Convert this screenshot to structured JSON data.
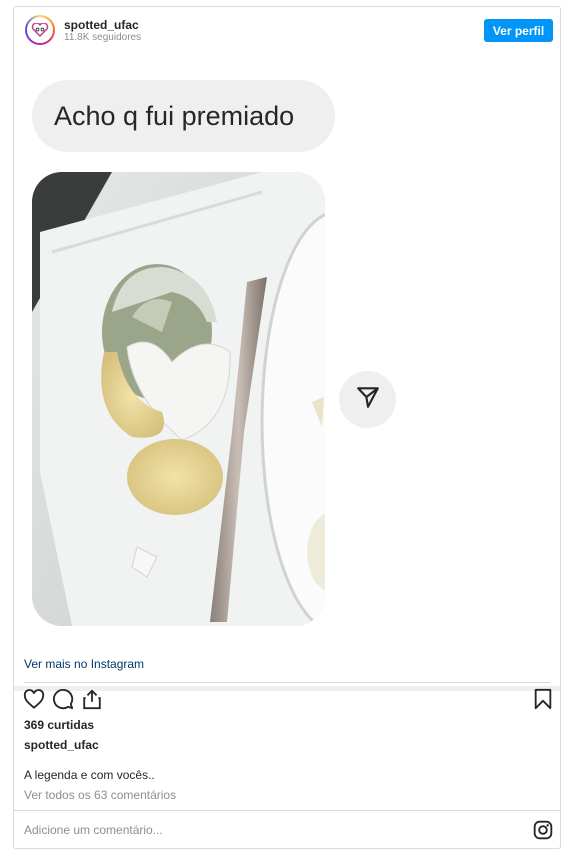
{
  "header": {
    "username": "spotted_ufac",
    "followers": "11.8K seguidores",
    "view_profile_label": "Ver perfil"
  },
  "post": {
    "bubble_text": "Acho q fui premiado"
  },
  "footer": {
    "view_more_label": "Ver mais no Instagram",
    "likes": "369 curtidas",
    "caption_username": "spotted_ufac",
    "caption": "A legenda e com vocês..",
    "view_comments": "Ver todos os 63 comentários",
    "comment_placeholder": "Adicione um comentário..."
  },
  "icons": {
    "avatar": "avatar-logo",
    "send": "send-icon",
    "like": "heart-icon",
    "comment": "comment-icon",
    "share": "share-icon",
    "save": "bookmark-icon",
    "instagram": "instagram-icon"
  },
  "colors": {
    "accent": "#0095f6",
    "link": "#00376b",
    "muted": "#8e8e8e",
    "bubble": "#efefef",
    "border": "#dbdbdb"
  }
}
